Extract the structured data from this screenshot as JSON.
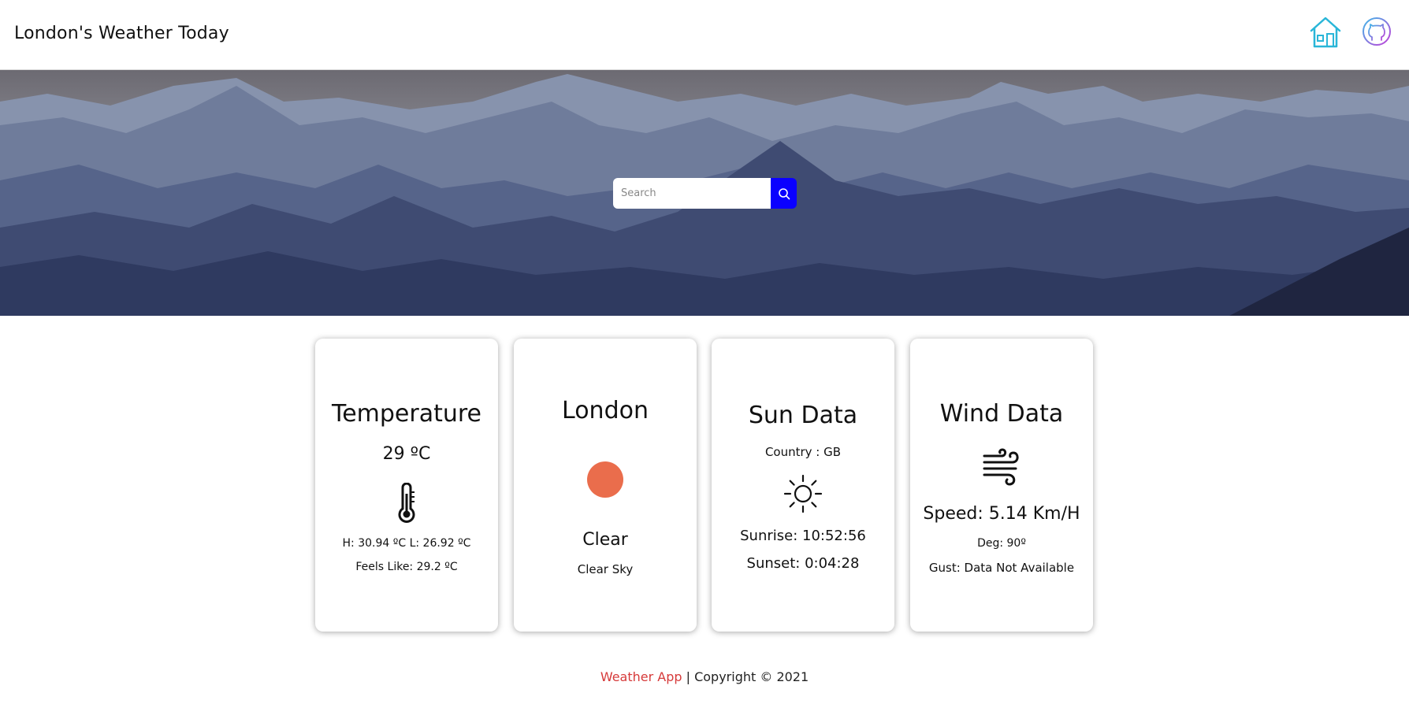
{
  "header": {
    "title": "London's Weather Today",
    "home_icon": "home-icon",
    "github_icon": "github-icon"
  },
  "search": {
    "placeholder": "Search",
    "value": "",
    "button_icon": "search-icon"
  },
  "cards": {
    "temperature": {
      "title": "Temperature",
      "value": "29 ºC",
      "icon": "thermometer-icon",
      "high_low": "H: 30.94 ºC L: 26.92 ºC",
      "feels_like": "Feels Like: 29.2 ºC"
    },
    "city": {
      "title": "London",
      "icon": "sun-disc-icon",
      "condition": "Clear",
      "description": "Clear Sky"
    },
    "sun": {
      "title": "Sun Data",
      "country": "Country : GB",
      "icon": "sun-icon",
      "sunrise": "Sunrise: 10:52:56",
      "sunset": "Sunset: 0:04:28"
    },
    "wind": {
      "title": "Wind Data",
      "icon": "wind-icon",
      "speed": "Speed: 5.14 Km/H",
      "deg": "Deg: 90º",
      "gust": "Gust: Data Not Available"
    }
  },
  "footer": {
    "brand": "Weather App",
    "copyright": " | Copyright © 2021"
  },
  "colors": {
    "accent_blue": "#0a00ff",
    "home_icon": "#29b6d8",
    "sun_disc": "#ea6d4c",
    "footer_brand": "#d63a3a"
  }
}
